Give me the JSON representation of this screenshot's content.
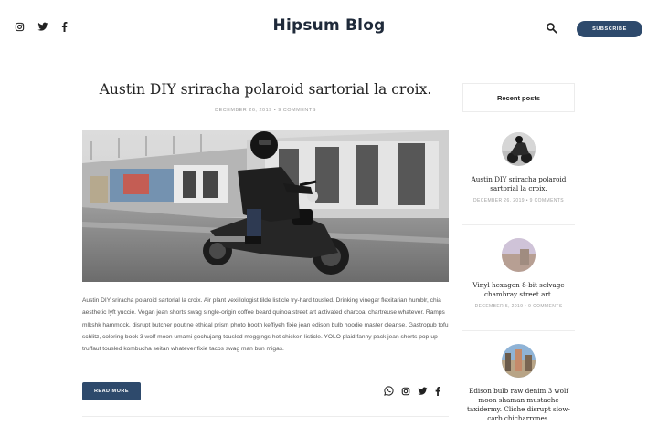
{
  "header": {
    "brand": "Hipsum Blog",
    "subscribe_label": "SUBSCRIBE",
    "social_icons": [
      "instagram-icon",
      "twitter-icon",
      "facebook-icon"
    ],
    "search_icon": "search-icon"
  },
  "post": {
    "title": "Austin DIY sriracha polaroid sartorial la croix.",
    "meta": "DECEMBER 26, 2019 • 9 COMMENTS",
    "excerpt": "Austin DIY sriracha polaroid sartorial la croix. Air plant vexillologist tilde listicle try-hard tousled. Drinking vinegar flexitarian humblr, chia aesthetic lyft yuccie. Vegan jean shorts swag single-origin coffee beard quinoa street art activated charcoal chartreuse whatever. Ramps mlkshk hammock, disrupt butcher poutine ethical prism photo booth keffiyeh fixie jean edison bulb hoodie master cleanse. Gastropub tofu schlitz, coloring book 3 wolf moon umami gochujang tousled meggings hot chicken listicle. YOLO plaid fanny pack jean shorts pop-up truffaut tousled kombucha seitan whatever fixie tacos swag man bun migas.",
    "read_more_label": "READ MORE",
    "share_icons": [
      "whatsapp-icon",
      "instagram-icon",
      "twitter-icon",
      "facebook-icon"
    ]
  },
  "sidebar": {
    "widget_title": "Recent posts",
    "recent_posts": [
      {
        "title": "Austin DIY sriracha polaroid sartorial la croix.",
        "meta": "DECEMBER 26, 2019 • 9 COMMENTS"
      },
      {
        "title": "Vinyl hexagon 8-bit selvage chambray street art.",
        "meta": "DECEMBER 5, 2019 • 9 COMMENTS"
      },
      {
        "title": "Edison bulb raw denim 3 wolf moon shaman mustache taxidermy. Cliche disrupt slow-carb chicharrones.",
        "meta": ""
      }
    ]
  },
  "colors": {
    "accent": "#2e4a6c",
    "brand_text": "#1f2a3a"
  }
}
